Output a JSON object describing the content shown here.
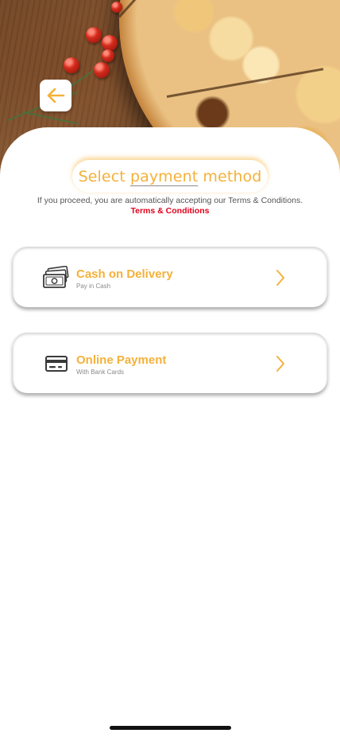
{
  "header": {
    "hero_image": "pizza-on-wooden-board",
    "back_icon": "arrow-left-icon"
  },
  "colors": {
    "accent": "#f4b13a",
    "link_red": "#e0001b",
    "text_gray": "#555555",
    "sub_gray": "#8a8a8a"
  },
  "page": {
    "title_prefix": "Select ",
    "title_underlined": "payment",
    "title_suffix": " method",
    "terms_notice": "If you proceed, you are automatically accepting our Terms & Conditions.",
    "terms_link": "Terms & Conditions"
  },
  "payment_methods": [
    {
      "title": "Cash on Delivery",
      "subtitle": "Pay in Cash",
      "icon": "cash-icon"
    },
    {
      "title": "Online Payment",
      "subtitle": "With Bank Cards",
      "icon": "credit-card-icon"
    }
  ]
}
